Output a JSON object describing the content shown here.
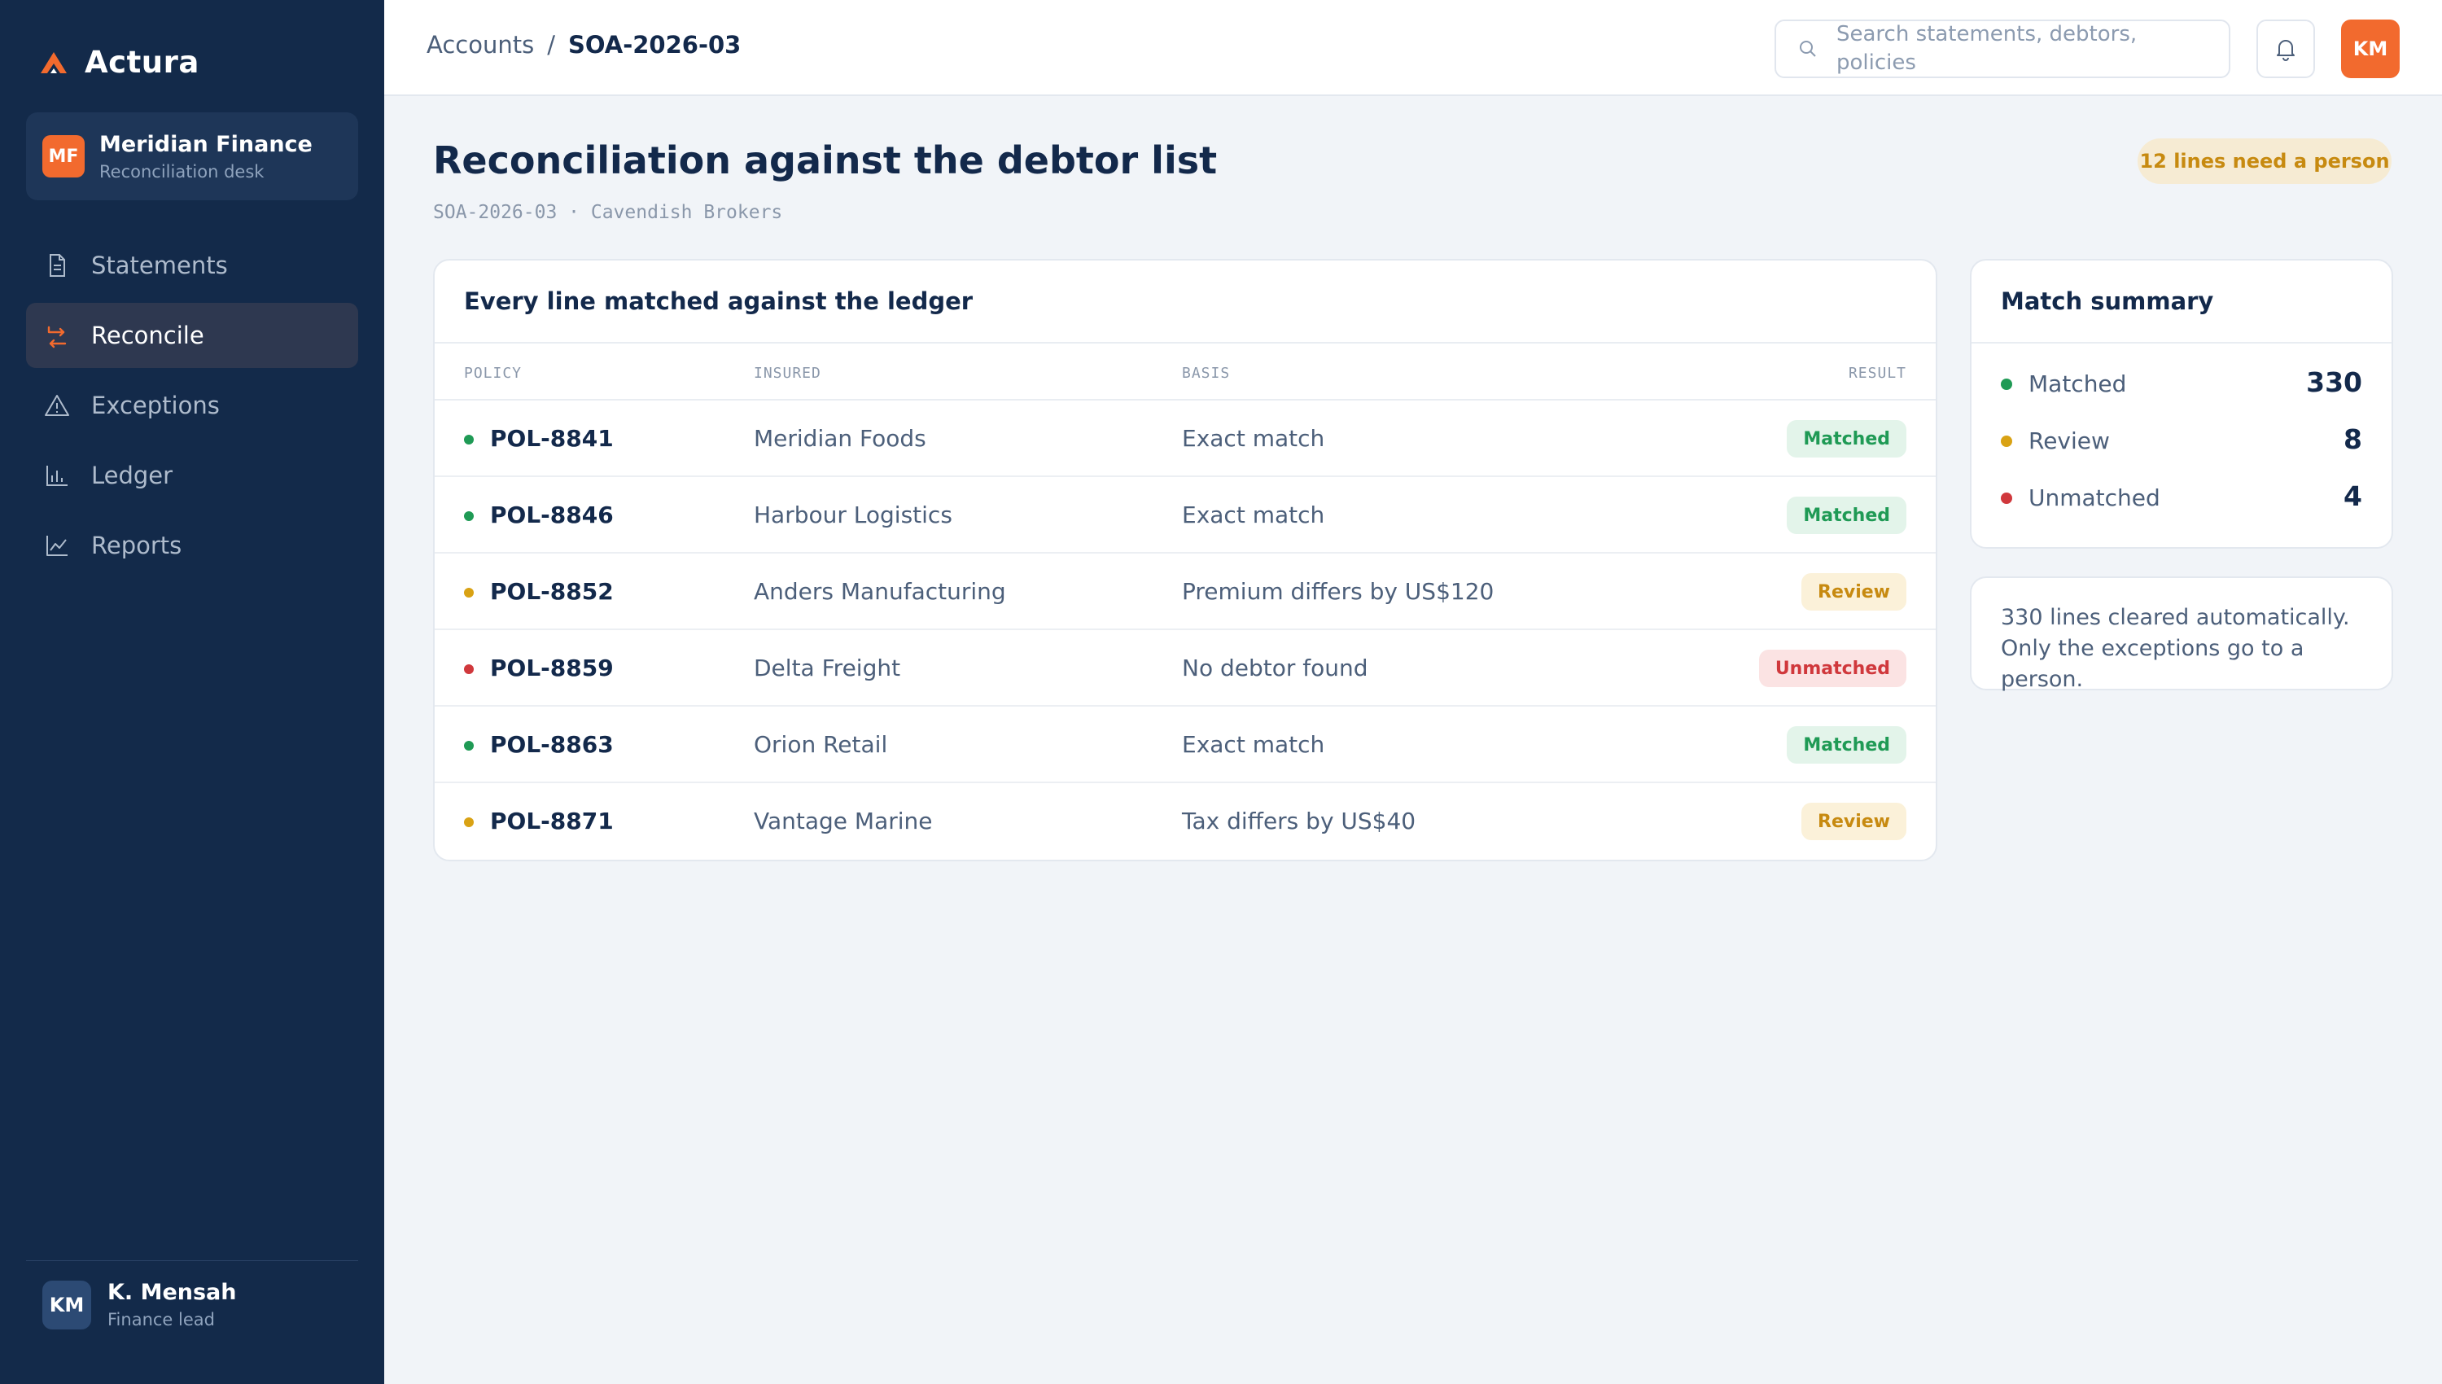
{
  "app": {
    "name": "Actura"
  },
  "org": {
    "initials": "MF",
    "name": "Meridian Finance",
    "subtitle": "Reconciliation desk"
  },
  "nav": {
    "items": [
      {
        "label": "Statements",
        "icon": "document-icon",
        "active": false
      },
      {
        "label": "Reconcile",
        "icon": "reconcile-arrows-icon",
        "active": true
      },
      {
        "label": "Exceptions",
        "icon": "warning-icon",
        "active": false
      },
      {
        "label": "Ledger",
        "icon": "bar-chart-icon",
        "active": false
      },
      {
        "label": "Reports",
        "icon": "line-chart-icon",
        "active": false
      }
    ]
  },
  "user": {
    "initials": "KM",
    "name": "K. Mensah",
    "role": "Finance lead"
  },
  "topbar": {
    "breadcrumb": {
      "parent": "Accounts",
      "separator": "/",
      "current": "SOA-2026-03"
    },
    "search_placeholder": "Search statements, debtors, policies",
    "avatar_initials": "KM"
  },
  "page": {
    "title": "Reconciliation against the debtor list",
    "subtitle": "SOA-2026-03 · Cavendish Brokers",
    "alert": "12 lines need a person"
  },
  "table": {
    "title": "Every line matched against the ledger",
    "headers": {
      "policy": "POLICY",
      "insured": "INSURED",
      "basis": "BASIS",
      "result": "RESULT"
    },
    "rows": [
      {
        "policy": "POL-8841",
        "insured": "Meridian Foods",
        "basis": "Exact match",
        "result": "Matched",
        "status": "matched"
      },
      {
        "policy": "POL-8846",
        "insured": "Harbour Logistics",
        "basis": "Exact match",
        "result": "Matched",
        "status": "matched"
      },
      {
        "policy": "POL-8852",
        "insured": "Anders Manufacturing",
        "basis": "Premium differs by US$120",
        "result": "Review",
        "status": "review"
      },
      {
        "policy": "POL-8859",
        "insured": "Delta Freight",
        "basis": "No debtor found",
        "result": "Unmatched",
        "status": "unmatched"
      },
      {
        "policy": "POL-8863",
        "insured": "Orion Retail",
        "basis": "Exact match",
        "result": "Matched",
        "status": "matched"
      },
      {
        "policy": "POL-8871",
        "insured": "Vantage Marine",
        "basis": "Tax differs by US$40",
        "result": "Review",
        "status": "review"
      }
    ]
  },
  "summary": {
    "title": "Match summary",
    "items": [
      {
        "label": "Matched",
        "value": "330",
        "status": "matched"
      },
      {
        "label": "Review",
        "value": "8",
        "status": "review"
      },
      {
        "label": "Unmatched",
        "value": "4",
        "status": "unmatched"
      }
    ]
  },
  "note": {
    "line1": "330 lines cleared automatically.",
    "line2": "Only the exceptions go to a person."
  },
  "colors": {
    "matched": "#1F9A55",
    "review": "#D9A214",
    "unmatched": "#D0383C",
    "accent": "#F26A2E",
    "sidebar": "#132A4A"
  }
}
